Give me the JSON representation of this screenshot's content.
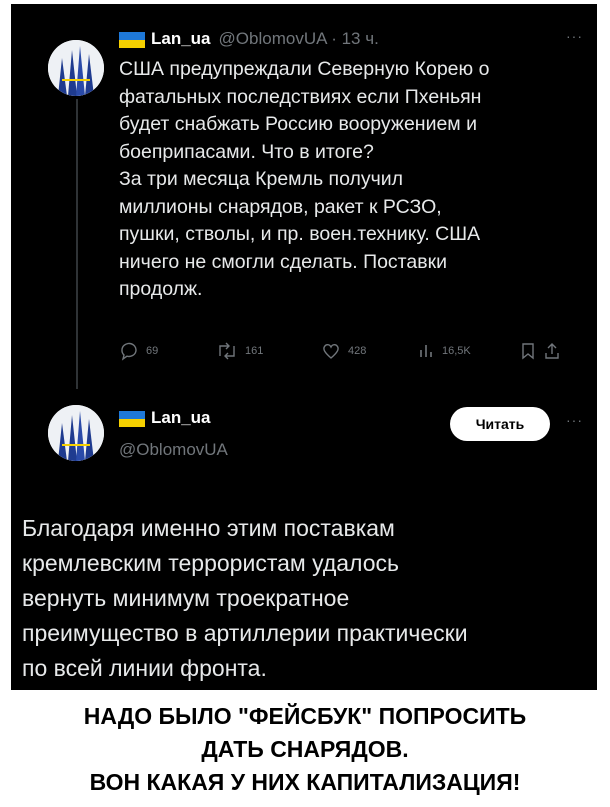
{
  "colors": {
    "background": "#000000",
    "text": "#e7e9ea",
    "muted": "#71767b",
    "flag_blue": "#1e78d8",
    "flag_yellow": "#f5d000",
    "button_bg": "#ffffff"
  },
  "tweet1": {
    "author_flag_icon": "ukraine-flag-icon",
    "author_name": "Lan_ua",
    "handle_time": "@OblomovUA · 13 ч.",
    "more": "···",
    "text_lines": [
      "США предупреждали Северную Корею о",
      "фатальных последствиях если Пхеньян",
      "будет снабжать Россию вооружением и",
      "боеприпасами. Что в итоге?",
      "За три месяца Кремль получил",
      "миллионы  снарядов, ракет к РСЗО,",
      "пушки, стволы, и пр. воен.технику. США",
      "ничего не смогли сделать. Поставки",
      "продолж."
    ],
    "actions": {
      "replies": "69",
      "reposts": "161",
      "likes": "428",
      "views": "16,5K"
    }
  },
  "tweet2": {
    "author_name": "Lan_ua",
    "handle": "@OblomovUA",
    "follow_label": "Читать",
    "more": "···",
    "text_lines": [
      "Благодаря именно этим поставкам",
      "кремлевским террористам удалось",
      "вернуть минимум троекратное",
      "преимущество в артиллерии практически",
      "по всей линии фронта."
    ]
  },
  "caption": {
    "lines": [
      "НАДО БЫЛО \"ФЕЙСБУК\" ПОПРОСИТЬ",
      "ДАТЬ СНАРЯДОВ.",
      "ВОН КАКАЯ У НИХ КАПИТАЛИЗАЦИЯ!"
    ]
  }
}
